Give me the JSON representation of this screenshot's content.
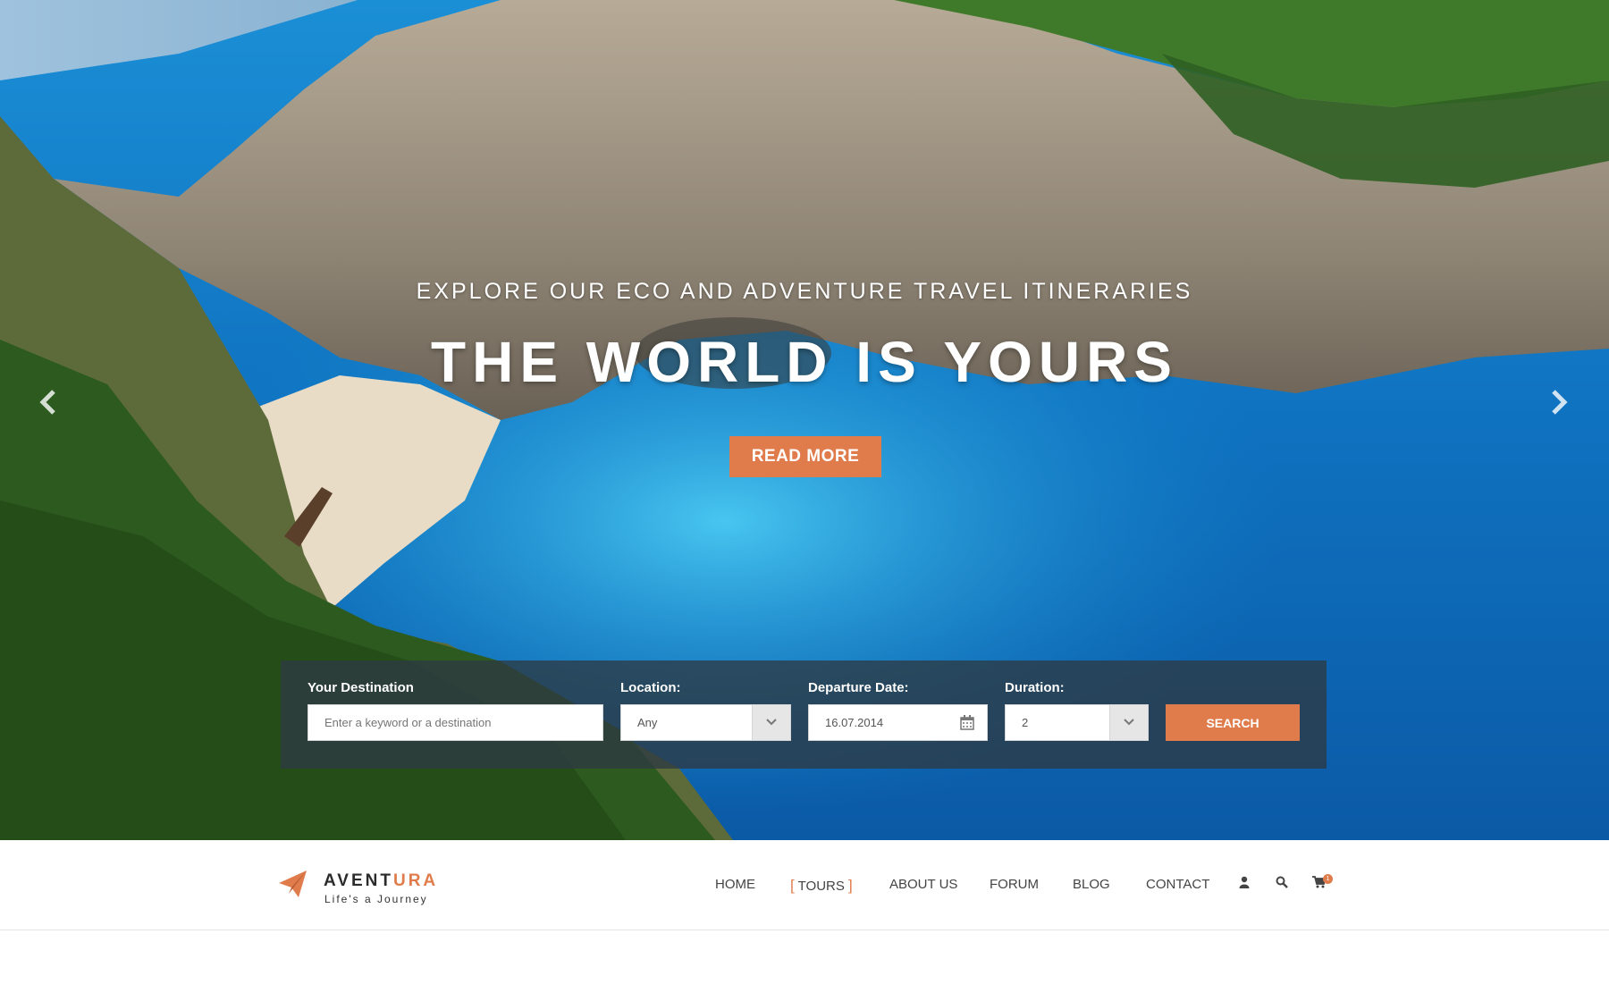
{
  "hero": {
    "subtitle": "EXPLORE OUR ECO AND ADVENTURE TRAVEL ITINERARIES",
    "title": "THE WORLD IS YOURS",
    "cta_label": "READ MORE"
  },
  "search": {
    "destination": {
      "label": "Your Destination",
      "placeholder": "Enter a keyword or a destination"
    },
    "location": {
      "label": "Location:",
      "value": "Any"
    },
    "departure": {
      "label": "Departure Date:",
      "value": "16.07.2014"
    },
    "duration": {
      "label": "Duration:",
      "value": "2"
    },
    "submit_label": "SEARCH"
  },
  "brand": {
    "name_main": "AVENT",
    "name_accent": "URA",
    "tagline": "Life's a Journey"
  },
  "nav": {
    "items": [
      {
        "label": "HOME",
        "active": false
      },
      {
        "label": "TOURS",
        "active": true
      },
      {
        "label": "ABOUT US",
        "active": false
      },
      {
        "label": "FORUM",
        "active": false
      },
      {
        "label": "BLOG",
        "active": false
      },
      {
        "label": "CONTACT",
        "active": false
      }
    ],
    "icons": [
      "user-icon",
      "search-icon",
      "cart-icon"
    ],
    "cart_count": "1"
  },
  "colors": {
    "accent": "#e07c4c",
    "panel": "#2d3a42",
    "text_dark": "#444444"
  }
}
